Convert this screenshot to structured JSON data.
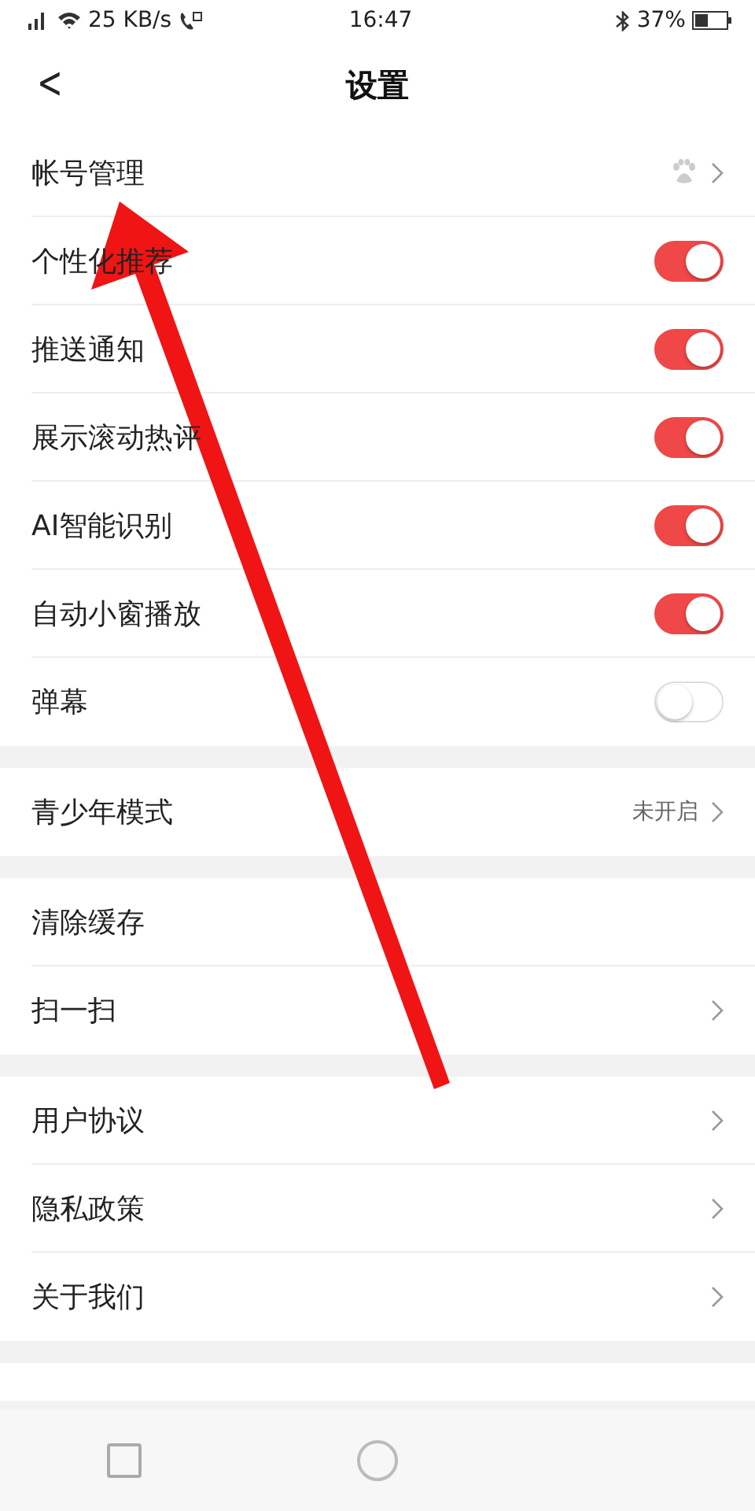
{
  "status_bar": {
    "speed": "25 KB/s",
    "time": "16:47",
    "battery": "37%"
  },
  "header": {
    "back": "<",
    "title": "设置"
  },
  "groups": [
    {
      "items": [
        {
          "kind": "link",
          "label": "帐号管理",
          "paw": true
        },
        {
          "kind": "toggle",
          "label": "个性化推荐",
          "on": true
        },
        {
          "kind": "toggle",
          "label": "推送通知",
          "on": true
        },
        {
          "kind": "toggle",
          "label": "展示滚动热评",
          "on": true
        },
        {
          "kind": "toggle",
          "label": "AI智能识别",
          "on": true
        },
        {
          "kind": "toggle",
          "label": "自动小窗播放",
          "on": true
        },
        {
          "kind": "toggle",
          "label": "弹幕",
          "on": false
        }
      ]
    },
    {
      "items": [
        {
          "kind": "link",
          "label": "青少年模式",
          "value": "未开启"
        }
      ]
    },
    {
      "items": [
        {
          "kind": "plain",
          "label": "清除缓存"
        },
        {
          "kind": "link",
          "label": "扫一扫"
        }
      ]
    },
    {
      "items": [
        {
          "kind": "link",
          "label": "用户协议"
        },
        {
          "kind": "link",
          "label": "隐私政策"
        },
        {
          "kind": "link",
          "label": "关于我们"
        }
      ]
    }
  ]
}
